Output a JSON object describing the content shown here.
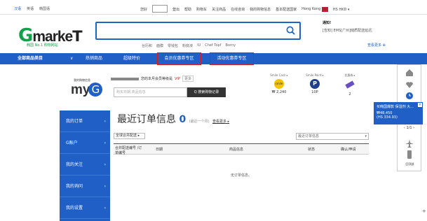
{
  "top_left": {
    "items": [
      "汉语",
      "英语",
      "韩国语"
    ]
  },
  "top_right": {
    "login_label": "登出",
    "items": [
      "帮助",
      "购物车",
      "关注商品",
      "在线咨询",
      "我的购物信息",
      "基本配送国家"
    ],
    "country": "Hong Kong",
    "currency": "HS HKD ▾"
  },
  "brand": {
    "logo": "Gmarket",
    "tagline": "韩国 No.1 购物网站"
  },
  "search": {
    "keywords": [
      "台历和",
      "面膜",
      "零钱包",
      "粉底液",
      "IU",
      "Chef Topf",
      "Borny"
    ]
  },
  "notice": {
    "title": "通知!",
    "text": "[告知] EMS[广州]储质配送延迟,",
    "more": "查看更多"
  },
  "nav": {
    "items": [
      "全部商品类目",
      "热销商品",
      "超级特价",
      "会员优惠券专区",
      "活动优惠券专区"
    ]
  },
  "myg": {
    "small": "我的购物信息",
    "logo": "myG",
    "grade_prefix": "您的本月会员等级是",
    "grade": "VIP",
    "change": "更多",
    "search_placeholder": "购买日期,商品信息",
    "search_button": "Q 搜索购物记录"
  },
  "points": [
    {
      "label": "Smile Cash ▸",
      "value": "₩ 2,240"
    },
    {
      "label": "Smile Point ▸",
      "value": "10P"
    },
    {
      "label": "优惠券 ▸",
      "value": "2"
    }
  ],
  "sidebar": {
    "items": [
      "我的订单",
      "G账户",
      "我的关注",
      "我的询问",
      "我的设置"
    ]
  },
  "orders": {
    "title": "最近订单信息",
    "count": "0",
    "sub": "(最近一个月)",
    "more": "查看更多 ▸",
    "filter": "全球合并配送 ▸",
    "select": "最近订单信息",
    "headers": [
      "合并配送编号 /订单编号",
      "日期",
      "商品信息",
      "状态",
      "确认/申请"
    ],
    "empty": "无订单信息。"
  },
  "deal": {
    "title": "买韩国爆款 保湿剂 大...",
    "price": "₩48,450",
    "hkd": "(HS 334.93)"
  },
  "pager": {
    "text": "1/1"
  },
  "right_panel": {
    "footer": "回顶部"
  },
  "colors": {
    "accent": "#1f5fc6",
    "brand_green": "#12a04a",
    "highlight_red": "#e01818"
  }
}
